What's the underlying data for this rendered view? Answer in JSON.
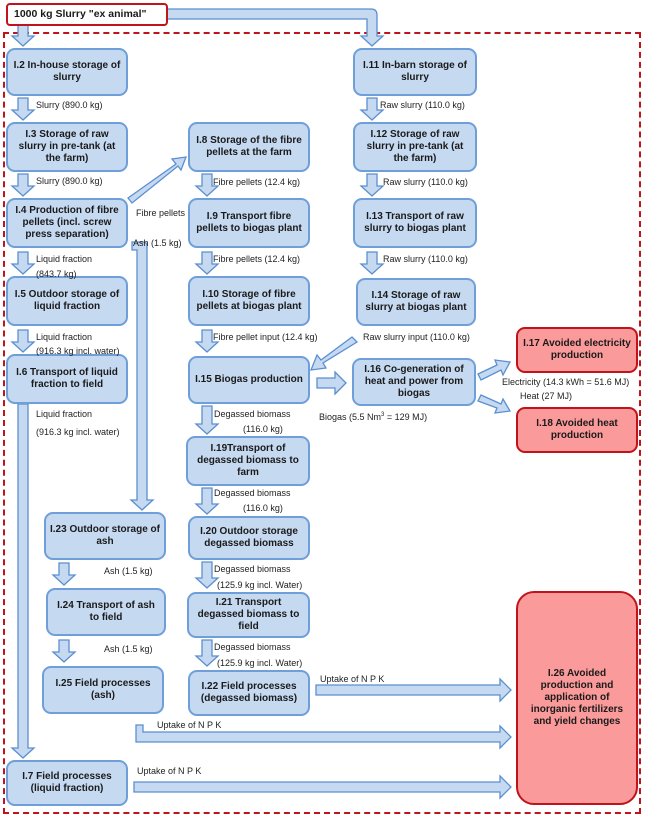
{
  "source": {
    "label": "1000 kg Slurry \"ex animal\""
  },
  "colors": {
    "process_fill": "#c5d9f1",
    "process_border": "#6f9fd8",
    "avoided_fill": "#fb9a9a",
    "avoided_border": "#c0141c",
    "boundary": "#c0141c"
  },
  "boxes": {
    "b1_2": "I.2 In-house storage of slurry",
    "b1_3": "I.3 Storage of raw slurry in pre-tank (at the farm)",
    "b1_4": "I.4 Production of fibre pellets (incl. screw press separation)",
    "b1_5": "I.5 Outdoor storage of liquid fraction",
    "b1_6": "I.6 Transport of liquid fraction to field",
    "b1_7": "I.7 Field processes (liquid fraction)",
    "b1_8": "I.8 Storage of the fibre pellets at the farm",
    "b1_9": "I.9 Transport fibre pellets to biogas plant",
    "b1_10": "I.10 Storage of fibre pellets at biogas plant",
    "b1_11": "I.11 In-barn storage of slurry",
    "b1_12": "I.12 Storage of raw slurry in pre-tank (at the farm)",
    "b1_13": "I.13 Transport of raw slurry to biogas plant",
    "b1_14": "I.14 Storage of raw slurry at biogas plant",
    "b1_15": "I.15 Biogas production",
    "b1_16": "I.16 Co-generation of heat and power from biogas",
    "b1_17": "I.17 Avoided electricity production",
    "b1_18": "I.18 Avoided heat production",
    "b1_19": "I.19Transport of degassed biomass to farm",
    "b1_20": "I.20 Outdoor storage degassed biomass",
    "b1_21": "I.21 Transport degassed biomass to field",
    "b1_22": "I.22 Field processes (degassed biomass)",
    "b1_23": "I.23 Outdoor storage of ash",
    "b1_24": "I.24 Transport of ash to field",
    "b1_25": "I.25 Field processes (ash)",
    "b1_26": "I.26 Avoided production and application of inorganic fertilizers and yield changes"
  },
  "flows": {
    "f2_3": "Slurry (890.0 kg)",
    "f3_4": "Slurry (890.0 kg)",
    "f4_8": "Fibre pellets",
    "f4_ash": "Ash (1.5 kg)",
    "f4_5a": "Liquid fraction",
    "f4_5b": "(843.7 kg)",
    "f5_6a": "Liquid fraction",
    "f5_6b": "(916.3 kg incl. water)",
    "f6_7a": "Liquid fraction",
    "f6_7b": "(916.3 kg incl. water)",
    "f8_9": "Fibre pellets (12.4 kg)",
    "f9_10": "Fibre pellets (12.4 kg)",
    "f10_15": "Fibre pellet input (12.4 kg)",
    "f11_12": "Raw slurry (110.0 kg)",
    "f12_13": "Raw slurry (110.0 kg)",
    "f13_14": "Raw slurry (110.0 kg)",
    "f14_15": "Raw slurry input (110.0 kg)",
    "f15_16": "Biogas (5.5 Nm",
    "f15_16_sup": "3",
    "f15_16_end": " = 129 MJ)",
    "f16_17": "Electricity (14.3 kWh = 51.6 MJ)",
    "f16_18": "Heat (27 MJ)",
    "f15_19a": "Degassed biomass",
    "f15_19b": "(116.0 kg)",
    "f19_20a": "Degassed biomass",
    "f19_20b": "(116.0 kg)",
    "f20_21a": "Degassed biomass",
    "f20_21b": "(125.9 kg incl. Water)",
    "f21_22a": "Degassed biomass",
    "f21_22b": "(125.9 kg incl. Water)",
    "f23_24": "Ash (1.5 kg)",
    "f24_25": "Ash (1.5 kg)",
    "f22_26": "Uptake of N P K",
    "f25_26": "Uptake of N P K",
    "f7_26": "Uptake of N P K"
  }
}
